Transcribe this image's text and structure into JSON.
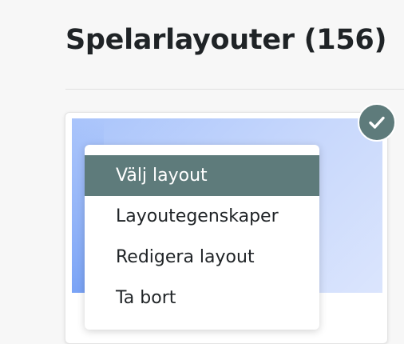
{
  "header": {
    "title": "Spelarlayouter (156)"
  },
  "layout_card": {
    "selected": true,
    "selected_icon": "check-icon",
    "accent_color": "#5e7b7b"
  },
  "context_menu": {
    "items": [
      {
        "label": "Välj layout",
        "active": true
      },
      {
        "label": "Layoutegenskaper",
        "active": false
      },
      {
        "label": "Redigera layout",
        "active": false
      },
      {
        "label": "Ta bort",
        "active": false
      }
    ]
  }
}
